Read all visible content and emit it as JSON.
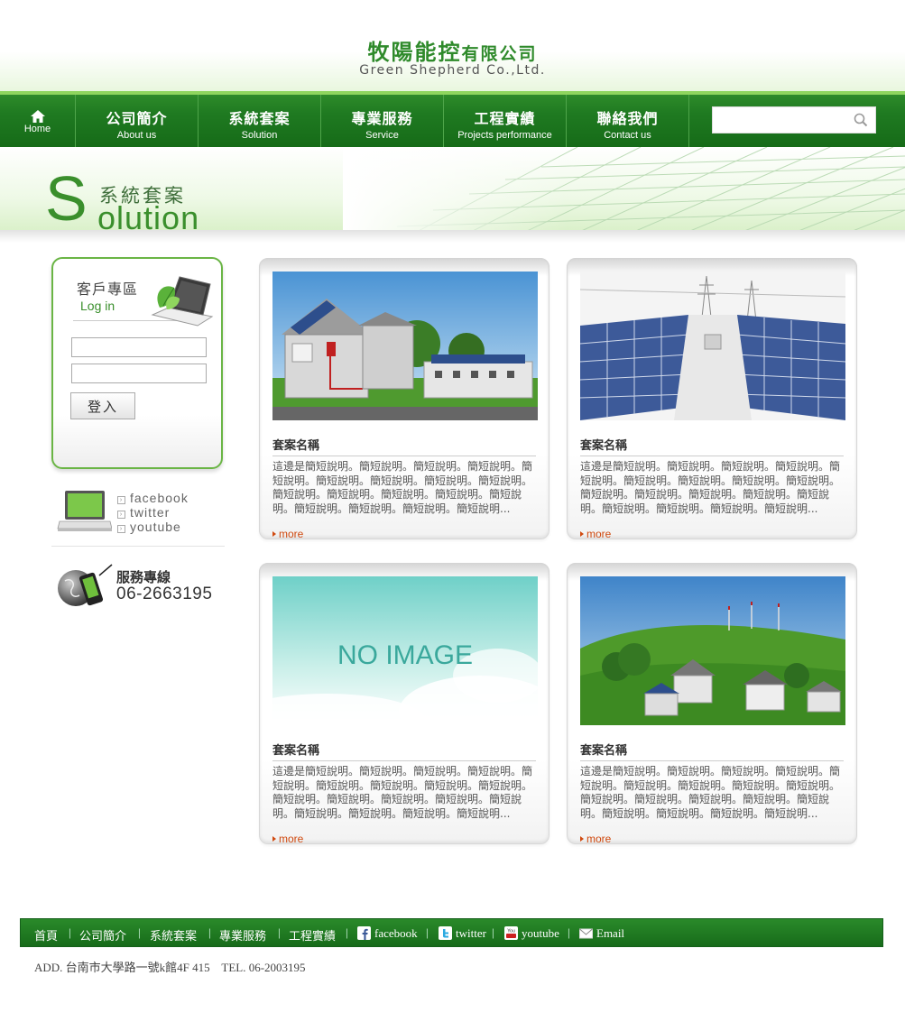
{
  "header": {
    "logo_cn_main": "牧陽能控",
    "logo_cn_sub": "有限公司",
    "logo_en": "Green Shepherd Co.,Ltd."
  },
  "nav": {
    "home_label": "Home",
    "items": [
      {
        "cn": "公司簡介",
        "en": "About us"
      },
      {
        "cn": "系統套案",
        "en": "Solution"
      },
      {
        "cn": "專業服務",
        "en": "Service"
      },
      {
        "cn": "工程實績",
        "en": "Projects performance"
      },
      {
        "cn": "聯絡我們",
        "en": "Contact us"
      }
    ],
    "search_value": ""
  },
  "banner": {
    "title_cn": "系統套案",
    "title_initial": "S",
    "title_rest": "olution"
  },
  "sidebar": {
    "login_title_cn": "客戶專區",
    "login_title_en": "Log in",
    "username_value": "",
    "password_value": "",
    "login_button": "登入",
    "social": [
      "facebook",
      "twitter",
      "youtube"
    ],
    "hotline_label": "服務專線",
    "hotline_number": "06-2663195"
  },
  "cards": [
    {
      "title": "套案名稱",
      "image": "house-solar-illustration",
      "desc": "這邊是簡短說明。簡短說明。簡短說明。簡短說明。簡短說明。簡短說明。簡短說明。簡短說明。簡短說明。簡短說明。簡短說明。簡短說明。簡短說明。簡短說明。簡短說明。簡短說明。簡短說明。簡短說明...",
      "more": "more"
    },
    {
      "title": "套案名稱",
      "image": "solar-farm-illustration",
      "desc": "這邊是簡短說明。簡短說明。簡短說明。簡短說明。簡短說明。簡短說明。簡短說明。簡短說明。簡短說明。簡短說明。簡短說明。簡短說明。簡短說明。簡短說明。簡短說明。簡短說明。簡短說明。簡短說明...",
      "more": "more"
    },
    {
      "title": "套案名稱",
      "image": "no-image-placeholder",
      "image_text": "NO IMAGE",
      "desc": "這邊是簡短說明。簡短說明。簡短說明。簡短說明。簡短說明。簡短說明。簡短說明。簡短說明。簡短說明。簡短說明。簡短說明。簡短說明。簡短說明。簡短說明。簡短說明。簡短說明。簡短說明。簡短說明...",
      "more": "more"
    },
    {
      "title": "套案名稱",
      "image": "village-wind-illustration",
      "desc": "這邊是簡短說明。簡短說明。簡短說明。簡短說明。簡短說明。簡短說明。簡短說明。簡短說明。簡短說明。簡短說明。簡短說明。簡短說明。簡短說明。簡短說明。簡短說明。簡短說明。簡短說明。簡短說明...",
      "more": "more"
    }
  ],
  "footer": {
    "links": [
      "首頁",
      "公司簡介",
      "系統套案",
      "專業服務",
      "工程實績"
    ],
    "social": [
      "facebook",
      "twitter",
      "youtube",
      "Email"
    ],
    "address": "ADD. 台南市大學路一號k館4F 415    TEL. 06-2003195"
  },
  "colors": {
    "brand_green": "#2e8b2a",
    "accent_light_green": "#8fd65e",
    "more_link": "#d04a10"
  }
}
